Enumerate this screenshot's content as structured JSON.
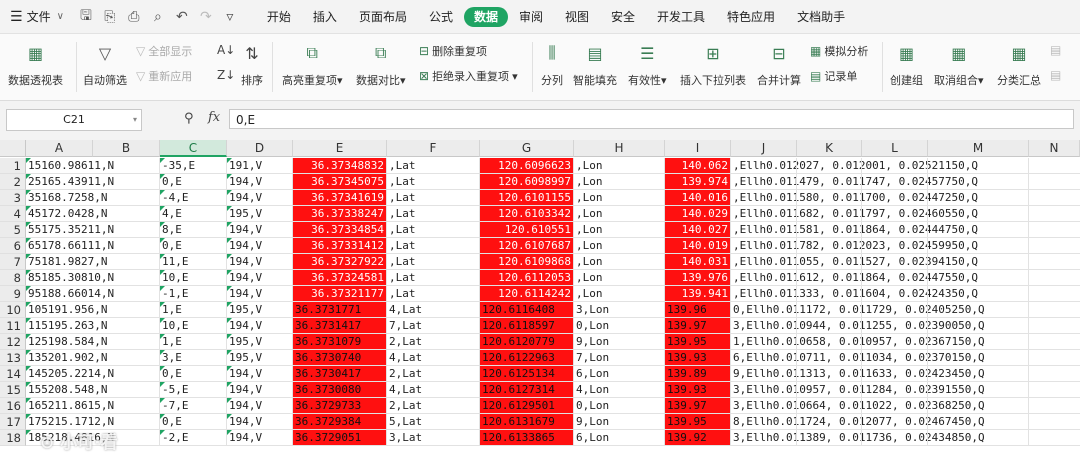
{
  "menu": {
    "file_label": "文件",
    "tabs": [
      "开始",
      "插入",
      "页面布局",
      "公式",
      "数据",
      "审阅",
      "视图",
      "安全",
      "开发工具",
      "特色应用",
      "文档助手"
    ],
    "active_tab": 4
  },
  "ribbon": {
    "pivot": "数据透视表",
    "autofilter": "自动筛选",
    "show_all": "全部显示",
    "reapply": "重新应用",
    "sort": "排序",
    "highlight_dup": "高亮重复项",
    "compare": "数据对比",
    "remove_dup": "删除重复项",
    "reject_dup": "拒绝录入重复项",
    "split": "分列",
    "smart_fill": "智能填充",
    "validity": "有效性",
    "dropdown_list": "插入下拉列表",
    "consolidate": "合并计算",
    "simulate": "模拟分析",
    "record": "记录单",
    "group": "创建组",
    "ungroup": "取消组合",
    "subtotal": "分类汇总"
  },
  "formula_bar": {
    "cell_ref": "C21",
    "fx": "fx",
    "value": "0,E"
  },
  "sheet": {
    "columns": [
      "A",
      "B",
      "C",
      "D",
      "E",
      "F",
      "G",
      "H",
      "I",
      "J",
      "K",
      "L",
      "M",
      "N"
    ],
    "selected_column": "C",
    "rows": [
      {
        "n": "1",
        "a": "15160.98611,N",
        "c": "-35,E",
        "d": "191,V",
        "e": "36.37348832",
        "f": ",Lat",
        "g": "120.6096623",
        "h": ",Lon",
        "i": "140.062",
        "j": ",Ellh0.012027,  0.012001,  0.02521150,Q"
      },
      {
        "n": "2",
        "a": "25165.43911,N",
        "c": "0,E",
        "d": "194,V",
        "e": "36.37345075",
        "f": ",Lat",
        "g": "120.6098997",
        "h": ",Lon",
        "i": "139.974",
        "j": ",Ellh0.011479,  0.011747,  0.02457750,Q"
      },
      {
        "n": "3",
        "a": "35168.7258,N",
        "c": "-4,E",
        "d": "194,V",
        "e": "36.37341619",
        "f": ",Lat",
        "g": "120.6101155",
        "h": ",Lon",
        "i": "140.016",
        "j": ",Ellh0.011580,  0.011700,  0.02447250,Q"
      },
      {
        "n": "4",
        "a": "45172.0428,N",
        "c": "4,E",
        "d": "195,V",
        "e": "36.37338247",
        "f": ",Lat",
        "g": "120.6103342",
        "h": ",Lon",
        "i": "140.029",
        "j": ",Ellh0.011682,  0.011797,  0.02460550,Q"
      },
      {
        "n": "5",
        "a": "55175.35211,N",
        "c": "8,E",
        "d": "194,V",
        "e": "36.37334854",
        "f": ",Lat",
        "g": "120.610551",
        "h": ",Lon",
        "i": "140.027",
        "j": ",Ellh0.011581,  0.011864,  0.02444750,Q"
      },
      {
        "n": "6",
        "a": "65178.66111,N",
        "c": "0,E",
        "d": "194,V",
        "e": "36.37331412",
        "f": ",Lat",
        "g": "120.6107687",
        "h": ",Lon",
        "i": "140.019",
        "j": ",Ellh0.011782,  0.012023,  0.02459950,Q"
      },
      {
        "n": "7",
        "a": "75181.9827,N",
        "c": "11,E",
        "d": "194,V",
        "e": "36.37327922",
        "f": ",Lat",
        "g": "120.6109868",
        "h": ",Lon",
        "i": "140.031",
        "j": ",Ellh0.011055,  0.011527,  0.02394150,Q"
      },
      {
        "n": "8",
        "a": "85185.30810,N",
        "c": "10,E",
        "d": "194,V",
        "e": "36.37324581",
        "f": ",Lat",
        "g": "120.6112053",
        "h": ",Lon",
        "i": "139.976",
        "j": ",Ellh0.011612,  0.011864,  0.02447550,Q"
      },
      {
        "n": "9",
        "a": "95188.66014,N",
        "c": "-1,E",
        "d": "194,V",
        "e": "36.37321177",
        "f": ",Lat",
        "g": "120.6114242",
        "h": ",Lon",
        "i": "139.941",
        "j": ",Ellh0.011333,  0.011604,  0.02424350,Q"
      },
      {
        "n": "10",
        "a": "105191.956,N",
        "c": "1,E",
        "d": "195,V",
        "e": "36.3731771",
        "f": "4,Lat",
        "g": "120.6116408",
        "h": "3,Lon",
        "i": "139.96",
        "j": "0,Ellh0.011172,  0.011729,  0.02405250,Q"
      },
      {
        "n": "11",
        "a": "115195.263,N",
        "c": "10,E",
        "d": "194,V",
        "e": "36.3731417",
        "f": "7,Lat",
        "g": "120.6118597",
        "h": "0,Lon",
        "i": "139.97",
        "j": "3,Ellh0.010944,  0.011255,  0.02390050,Q"
      },
      {
        "n": "12",
        "a": "125198.584,N",
        "c": "1,E",
        "d": "195,V",
        "e": "36.3731079",
        "f": "2,Lat",
        "g": "120.6120779",
        "h": "9,Lon",
        "i": "139.95",
        "j": "1,Ellh0.010658,  0.010957,  0.02367150,Q"
      },
      {
        "n": "13",
        "a": "135201.902,N",
        "c": "3,E",
        "d": "195,V",
        "e": "36.3730740",
        "f": "4,Lat",
        "g": "120.6122963",
        "h": "7,Lon",
        "i": "139.93",
        "j": "6,Ellh0.010711,  0.011034,  0.02370150,Q"
      },
      {
        "n": "14",
        "a": "145205.2214,N",
        "c": "0,E",
        "d": "194,V",
        "e": "36.3730417",
        "f": "2,Lat",
        "g": "120.6125134",
        "h": "6,Lon",
        "i": "139.89",
        "j": "9,Ellh0.011313,  0.011633,  0.02423450,Q"
      },
      {
        "n": "15",
        "a": "155208.548,N",
        "c": "-5,E",
        "d": "194,V",
        "e": "36.3730080",
        "f": "4,Lat",
        "g": "120.6127314",
        "h": "4,Lon",
        "i": "139.93",
        "j": "3,Ellh0.010957,  0.011284,  0.02391550,Q"
      },
      {
        "n": "16",
        "a": "165211.8615,N",
        "c": "-7,E",
        "d": "194,V",
        "e": "36.3729733",
        "f": "2,Lat",
        "g": "120.6129501",
        "h": "0,Lon",
        "i": "139.97",
        "j": "3,Ellh0.010664,  0.011022,  0.02368250,Q"
      },
      {
        "n": "17",
        "a": "175215.1712,N",
        "c": "0,E",
        "d": "194,V",
        "e": "36.3729384",
        "f": "5,Lat",
        "g": "120.6131679",
        "h": "9,Lon",
        "i": "139.95",
        "j": "8,Ellh0.011724,  0.012077,  0.02467450,Q"
      },
      {
        "n": "18",
        "a": "185218.4816,N",
        "c": "-2,E",
        "d": "194,V",
        "e": "36.3729051",
        "f": "3,Lat",
        "g": "120.6133865",
        "h": "6,Lon",
        "i": "139.92",
        "j": "3,Ellh0.011389,  0.011736,  0.02434850,Q"
      }
    ]
  },
  "colors": {
    "accent": "#1fa463",
    "highlight": "#ff1010"
  }
}
